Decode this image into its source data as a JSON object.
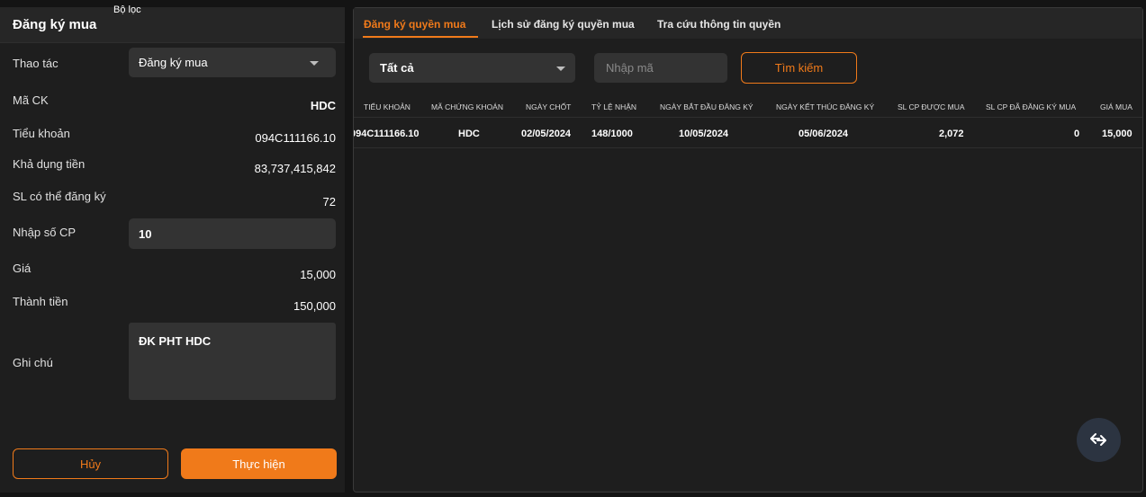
{
  "left_panel": {
    "title": "Đăng ký mua",
    "filter_label": "Bộ lọc",
    "rows": {
      "action_label": "Thao tác",
      "action_value": "Đăng ký mua",
      "symbol_label": "Mã CK",
      "symbol_value": "HDC",
      "subaccount_label": "Tiểu khoản",
      "subaccount_value": "094C111166.10",
      "cash_available_label": "Khả dụng tiền",
      "cash_available_value": "83,737,415,842",
      "max_qty_label": "SL có thể đăng ký",
      "max_qty_value": "72",
      "qty_input_label": "Nhập số CP",
      "qty_input_value": "10",
      "price_label": "Giá",
      "price_value": "15,000",
      "amount_label": "Thành tiền",
      "amount_value": "150,000",
      "note_label": "Ghi chú",
      "note_value": "ĐK PHT HDC"
    },
    "cancel_label": "Hủy",
    "submit_label": "Thực hiện"
  },
  "right_panel": {
    "tabs": [
      {
        "label": "Đăng ký quyền mua",
        "active": true
      },
      {
        "label": "Lịch sử đăng ký quyền mua",
        "active": false
      },
      {
        "label": "Tra cứu thông tin quyền",
        "active": false
      }
    ],
    "filter_select_value": "Tất cả",
    "code_input_placeholder": "Nhập mã",
    "search_label": "Tìm kiếm",
    "columns": [
      "TIỂU KHOẢN",
      "MÃ CHỨNG KHOÁN",
      "NGÀY CHỐT",
      "TỶ LỆ NHẬN",
      "NGÀY BẮT ĐẦU ĐĂNG KÝ",
      "NGÀY KẾT THÚC ĐĂNG KÝ",
      "SL CP ĐƯỢC MUA",
      "SL CP ĐÃ ĐĂNG KÝ MUA",
      "GIÁ MUA"
    ],
    "rows": [
      [
        "094C111166.10",
        "HDC",
        "02/05/2024",
        "148/1000",
        "10/05/2024",
        "05/06/2024",
        "2,072",
        "0",
        "15,000"
      ]
    ]
  },
  "fab_icon": "swap-arrows-icon",
  "colors": {
    "accent": "#f07a1a",
    "panel": "#1e1e1e",
    "input": "#333333",
    "fab": "#2c3441"
  }
}
